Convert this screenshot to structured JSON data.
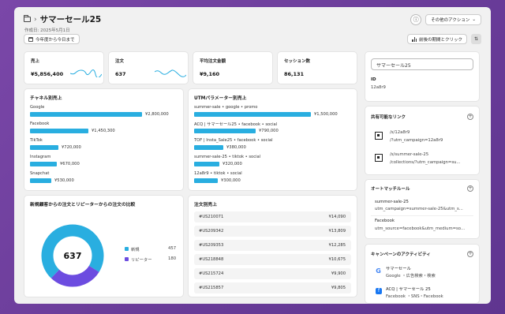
{
  "header": {
    "title": "サマーセール25",
    "subtitle": "作成日: 2025年5月1日",
    "info_label": "ⓘ",
    "actions_label": "その他のアクション"
  },
  "toolbar": {
    "date_range_label": "今年度から今日まで",
    "compare_label": "前後の期間とクリック"
  },
  "metrics": [
    {
      "label": "売上",
      "value": "¥5,856,400"
    },
    {
      "label": "注文",
      "value": "637"
    },
    {
      "label": "平均注文金額",
      "value": "¥9,160"
    },
    {
      "label": "セッション数",
      "value": "86,131"
    }
  ],
  "channel_sales": {
    "title": "チャネル別売上",
    "rows": [
      {
        "label": "Google",
        "value": "¥2,800,000",
        "fraction": 1.0
      },
      {
        "label": "Facebook",
        "value": "¥1,450,300",
        "fraction": 0.518
      },
      {
        "label": "TikTok",
        "value": "¥720,000",
        "fraction": 0.257
      },
      {
        "label": "Instagram",
        "value": "¥670,000",
        "fraction": 0.24
      },
      {
        "label": "Snapchat",
        "value": "¥530,000",
        "fraction": 0.19
      }
    ]
  },
  "utm_sales": {
    "title": "UTMパラメーター別売上",
    "rows": [
      {
        "label": "summer-sale • google • promo",
        "value": "¥1,500,000",
        "fraction": 1.0
      },
      {
        "label": "ACQ | サマーセール25 • facebook • social",
        "value": "¥790,000",
        "fraction": 0.527
      },
      {
        "label": "TOF | Insta_Sale25 • facebook • social",
        "value": "¥380,000",
        "fraction": 0.253
      },
      {
        "label": "summer-sale-25 • tiktok • social",
        "value": "¥320,000",
        "fraction": 0.213
      },
      {
        "label": "12a8r9 • tiktok • social",
        "value": "¥300,000",
        "fraction": 0.2
      }
    ]
  },
  "donut": {
    "title": "新規顧客からの注文とリピーターからの注文の比較",
    "total": "637",
    "segments": [
      {
        "label": "新規",
        "value": 457,
        "color": "#29aee0"
      },
      {
        "label": "リピーター",
        "value": 180,
        "color": "#6c4ce0"
      }
    ]
  },
  "orders": {
    "title": "注文別売上",
    "rows": [
      {
        "id": "#US210071",
        "amount": "¥14,090"
      },
      {
        "id": "#US209342",
        "amount": "¥13,809"
      },
      {
        "id": "#US209353",
        "amount": "¥12,285"
      },
      {
        "id": "#US218848",
        "amount": "¥10,675"
      },
      {
        "id": "#US215724",
        "amount": "¥9,900"
      },
      {
        "id": "#US215857",
        "amount": "¥9,805"
      }
    ]
  },
  "sidebar": {
    "name_value": "サマーセール25",
    "id_label": "ID",
    "id_value": "12a8r9",
    "links_title": "共有可能なリンク",
    "links": [
      {
        "short": "/s/12a8r9",
        "full": "/?utm_campaign=12a8r9"
      },
      {
        "short": "/s/summer-sale-25",
        "full": "/collections/?utm_campaign=su..."
      }
    ],
    "auto_title": "オートマッチルール",
    "auto_rules": [
      {
        "name": "summer-sale-25",
        "rule": "utm_campaign=summer-sale-25&utm_s..."
      },
      {
        "name": "Facebook",
        "rule": "utm_source=facebook&utm_medium=so..."
      }
    ],
    "activity_title": "キャンペーンのアクティビティ",
    "activities": [
      {
        "name": "サマーセール",
        "detail": "Google ・広告検索・検索"
      },
      {
        "name": "ACQ | サマーセール 25",
        "detail": "Facebook ・SNS・Facebook"
      }
    ]
  }
}
